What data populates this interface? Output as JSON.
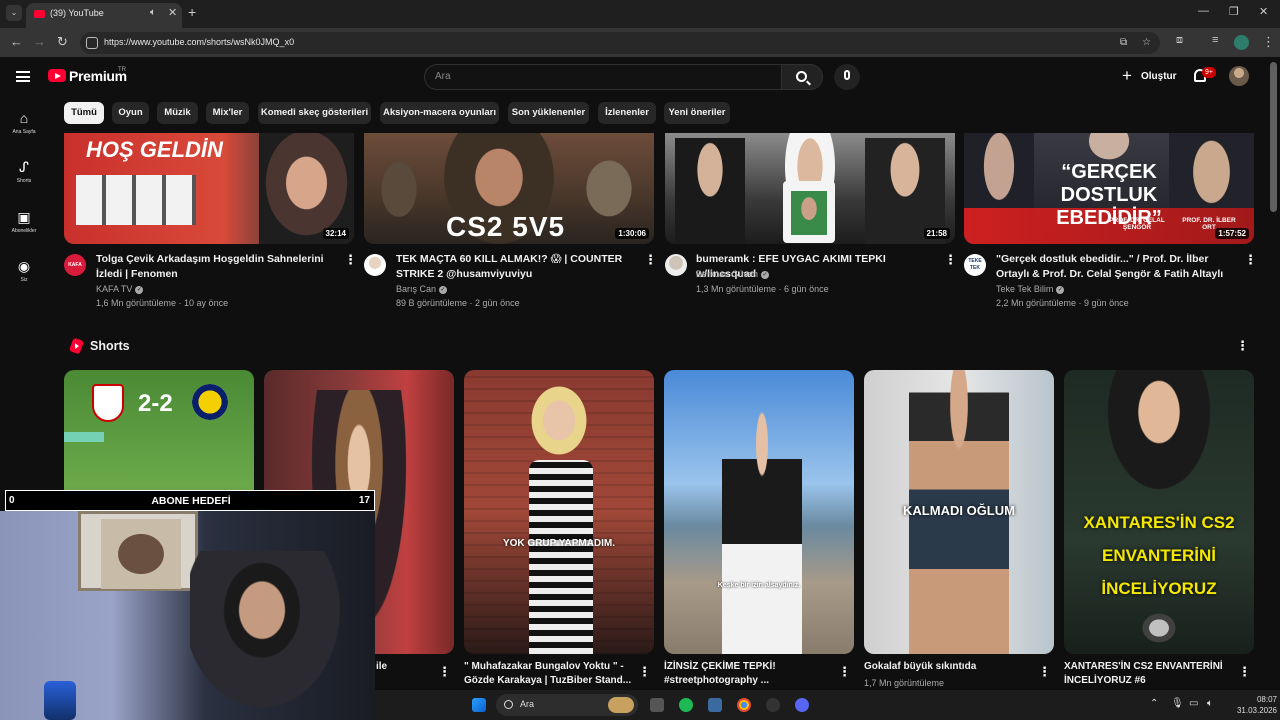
{
  "browser": {
    "tab_title": "(39) YouTube",
    "url": "https://www.youtube.com/shorts/wsNk0JMQ_x0"
  },
  "youtube": {
    "brand": "Premium",
    "region": "TR",
    "search_placeholder": "Ara",
    "create_label": "Oluştur",
    "notification_count": "9+",
    "sidebar": [
      {
        "label": "Ana Sayfa",
        "icon": "home-icon"
      },
      {
        "label": "Shorts",
        "icon": "shorts-icon"
      },
      {
        "label": "Abonelikler",
        "icon": "subscriptions-icon"
      },
      {
        "label": "Siz",
        "icon": "you-icon"
      }
    ],
    "chips": [
      "Tümü",
      "Oyun",
      "Müzik",
      "Mix'ler",
      "Komedi skeç gösterileri",
      "Aksiyon-macera oyunları",
      "Son yüklenenler",
      "İzlenenler",
      "Yeni öneriler"
    ],
    "videos": [
      {
        "title": "Tolga Çevik Arkadaşım Hoşgeldin Sahnelerini İzledi | Fenomen",
        "channel": "KAFA TV",
        "meta": "1,6 Mn görüntüleme · 10 ay önce",
        "duration": "32:14",
        "thumb_text": "HOŞ GELDİN",
        "channel_icon_text": "KAFA"
      },
      {
        "title": "TEK MAÇTA 60 KILL ALMAK!? 😱 | COUNTER STRIKE 2 @husamviyuviyu",
        "channel": "Barış Can",
        "meta": "89 B görüntüleme · 2 gün önce",
        "duration": "1:30:06",
        "thumb_text": "CS2 5V5"
      },
      {
        "title": "bumeramk : EFE UYGAC AKIMI TEPKI w/lincsquad",
        "channel": "Berkcan Güven",
        "meta": "1,3 Mn görüntüleme · 6 gün önce",
        "duration": "21:58"
      },
      {
        "title": "\"Gerçek dostluk ebedidir...\" / Prof. Dr. İlber Ortaylı & Prof. Dr. Celal Şengör & Fatih Altaylı",
        "channel": "Teke Tek Bilim",
        "meta": "2,2 Mn görüntüleme · 9 gün önce",
        "duration": "1:57:52",
        "thumb_text": "“GERÇEK DOSTLUK EBEDİDİR”",
        "caption_left": "PROF. DR. CELAL ŞENGÖR",
        "caption_right": "PROF. DR. İLBER ORT",
        "channel_icon_text": "TEKE TEK"
      }
    ],
    "shorts_heading": "Shorts",
    "shorts": [
      {
        "title": "",
        "views": "",
        "overlay": "2-2"
      },
      {
        "title": "ile",
        "views": "",
        "overlay": ""
      },
      {
        "title": "\" Muhafazakar Bungalov Yoktu \" - Gözde Karakaya | TuzBiber Stand...",
        "views": "",
        "overlay": "YOK GRUP YAPMADIM."
      },
      {
        "title": "İZİNSİZ ÇEKİME TEPKİ! #streetphotography ...",
        "views": "",
        "overlay": "Keşke bir izin alsaydınız."
      },
      {
        "title": "Gokalaf büyük sıkıntıda",
        "views": "1,7 Mn görüntüleme",
        "overlay": "KALMADI OĞLUM"
      },
      {
        "title": "XANTARES'İN CS2 ENVANTERİNİ İNCELİYORUZ #6",
        "views": "",
        "overlay": "XANTARES'İN CS2 ENVANTERİNİ İNCELİYORUZ"
      }
    ]
  },
  "overlay": {
    "abone_left": "0",
    "abone_label": "ABONE HEDEFİ",
    "abone_right": "17"
  },
  "taskbar": {
    "search_label": "Ara",
    "time": "08:07",
    "date": "31.03.2026"
  },
  "colors": {
    "bg": "#0f0f0f",
    "accent_red": "#ff0033",
    "chip_bg": "#272727",
    "chip_active": "#f1f1f1"
  }
}
